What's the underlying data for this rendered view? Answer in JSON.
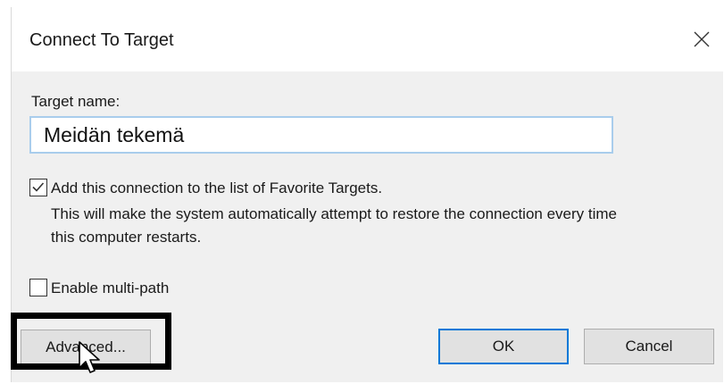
{
  "dialog": {
    "title": "Connect To Target",
    "close_glyph": "✕"
  },
  "target": {
    "label": "Target name:",
    "value": "Meidän tekemä"
  },
  "favorites": {
    "checked": true,
    "label": "Add this connection to the list of Favorite Targets.",
    "description": "This will make the system automatically attempt to restore the connection every time this computer restarts."
  },
  "multipath": {
    "checked": false,
    "label": "Enable multi-path"
  },
  "buttons": {
    "advanced": "Advanced...",
    "ok": "OK",
    "cancel": "Cancel"
  },
  "colors": {
    "accent": "#0078d7",
    "input_border": "#a9cdec",
    "highlight": "#000000"
  },
  "icons": {
    "close": "close-icon",
    "check": "checkmark-icon",
    "cursor": "mouse-pointer-icon"
  }
}
